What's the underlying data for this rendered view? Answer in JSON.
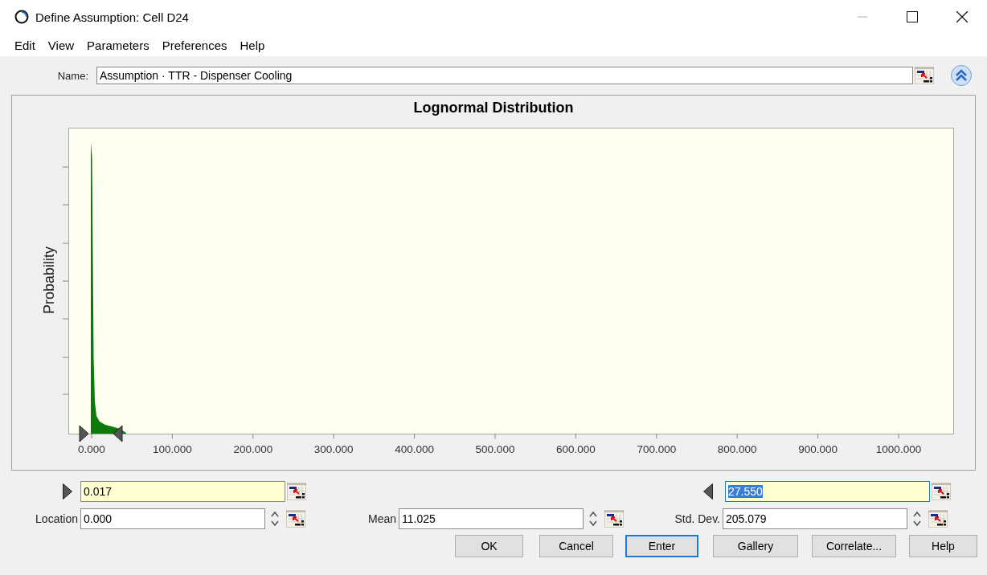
{
  "window": {
    "title": "Define Assumption: Cell D24"
  },
  "menu": [
    "Edit",
    "View",
    "Parameters",
    "Preferences",
    "Help"
  ],
  "name_field": {
    "label": "Name:",
    "value": "Assumption · TTR - Dispenser Cooling"
  },
  "chart": {
    "title": "Lognormal Distribution",
    "ylabel": "Probability",
    "x_tick_labels": [
      "0.000",
      "100.000",
      "200.000",
      "300.000",
      "400.000",
      "500.000",
      "600.000",
      "700.000",
      "800.000",
      "900.000",
      "1000.000"
    ]
  },
  "bounds": [
    {
      "value": "0.017",
      "focused": false,
      "text_selected": false
    },
    {
      "value": "27.550",
      "focused": true,
      "text_selected": true
    }
  ],
  "parameters": [
    {
      "label": "Location",
      "value": "0.000"
    },
    {
      "label": "Mean",
      "value": "11.025"
    },
    {
      "label": "Std. Dev.",
      "value": "205.079"
    }
  ],
  "buttons": [
    {
      "label": "OK",
      "default": false
    },
    {
      "label": "Cancel",
      "default": false
    },
    {
      "label": "Enter",
      "default": true
    },
    {
      "label": "Gallery",
      "default": false
    },
    {
      "label": "Correlate...",
      "default": false
    },
    {
      "label": "Help",
      "default": false
    }
  ]
}
